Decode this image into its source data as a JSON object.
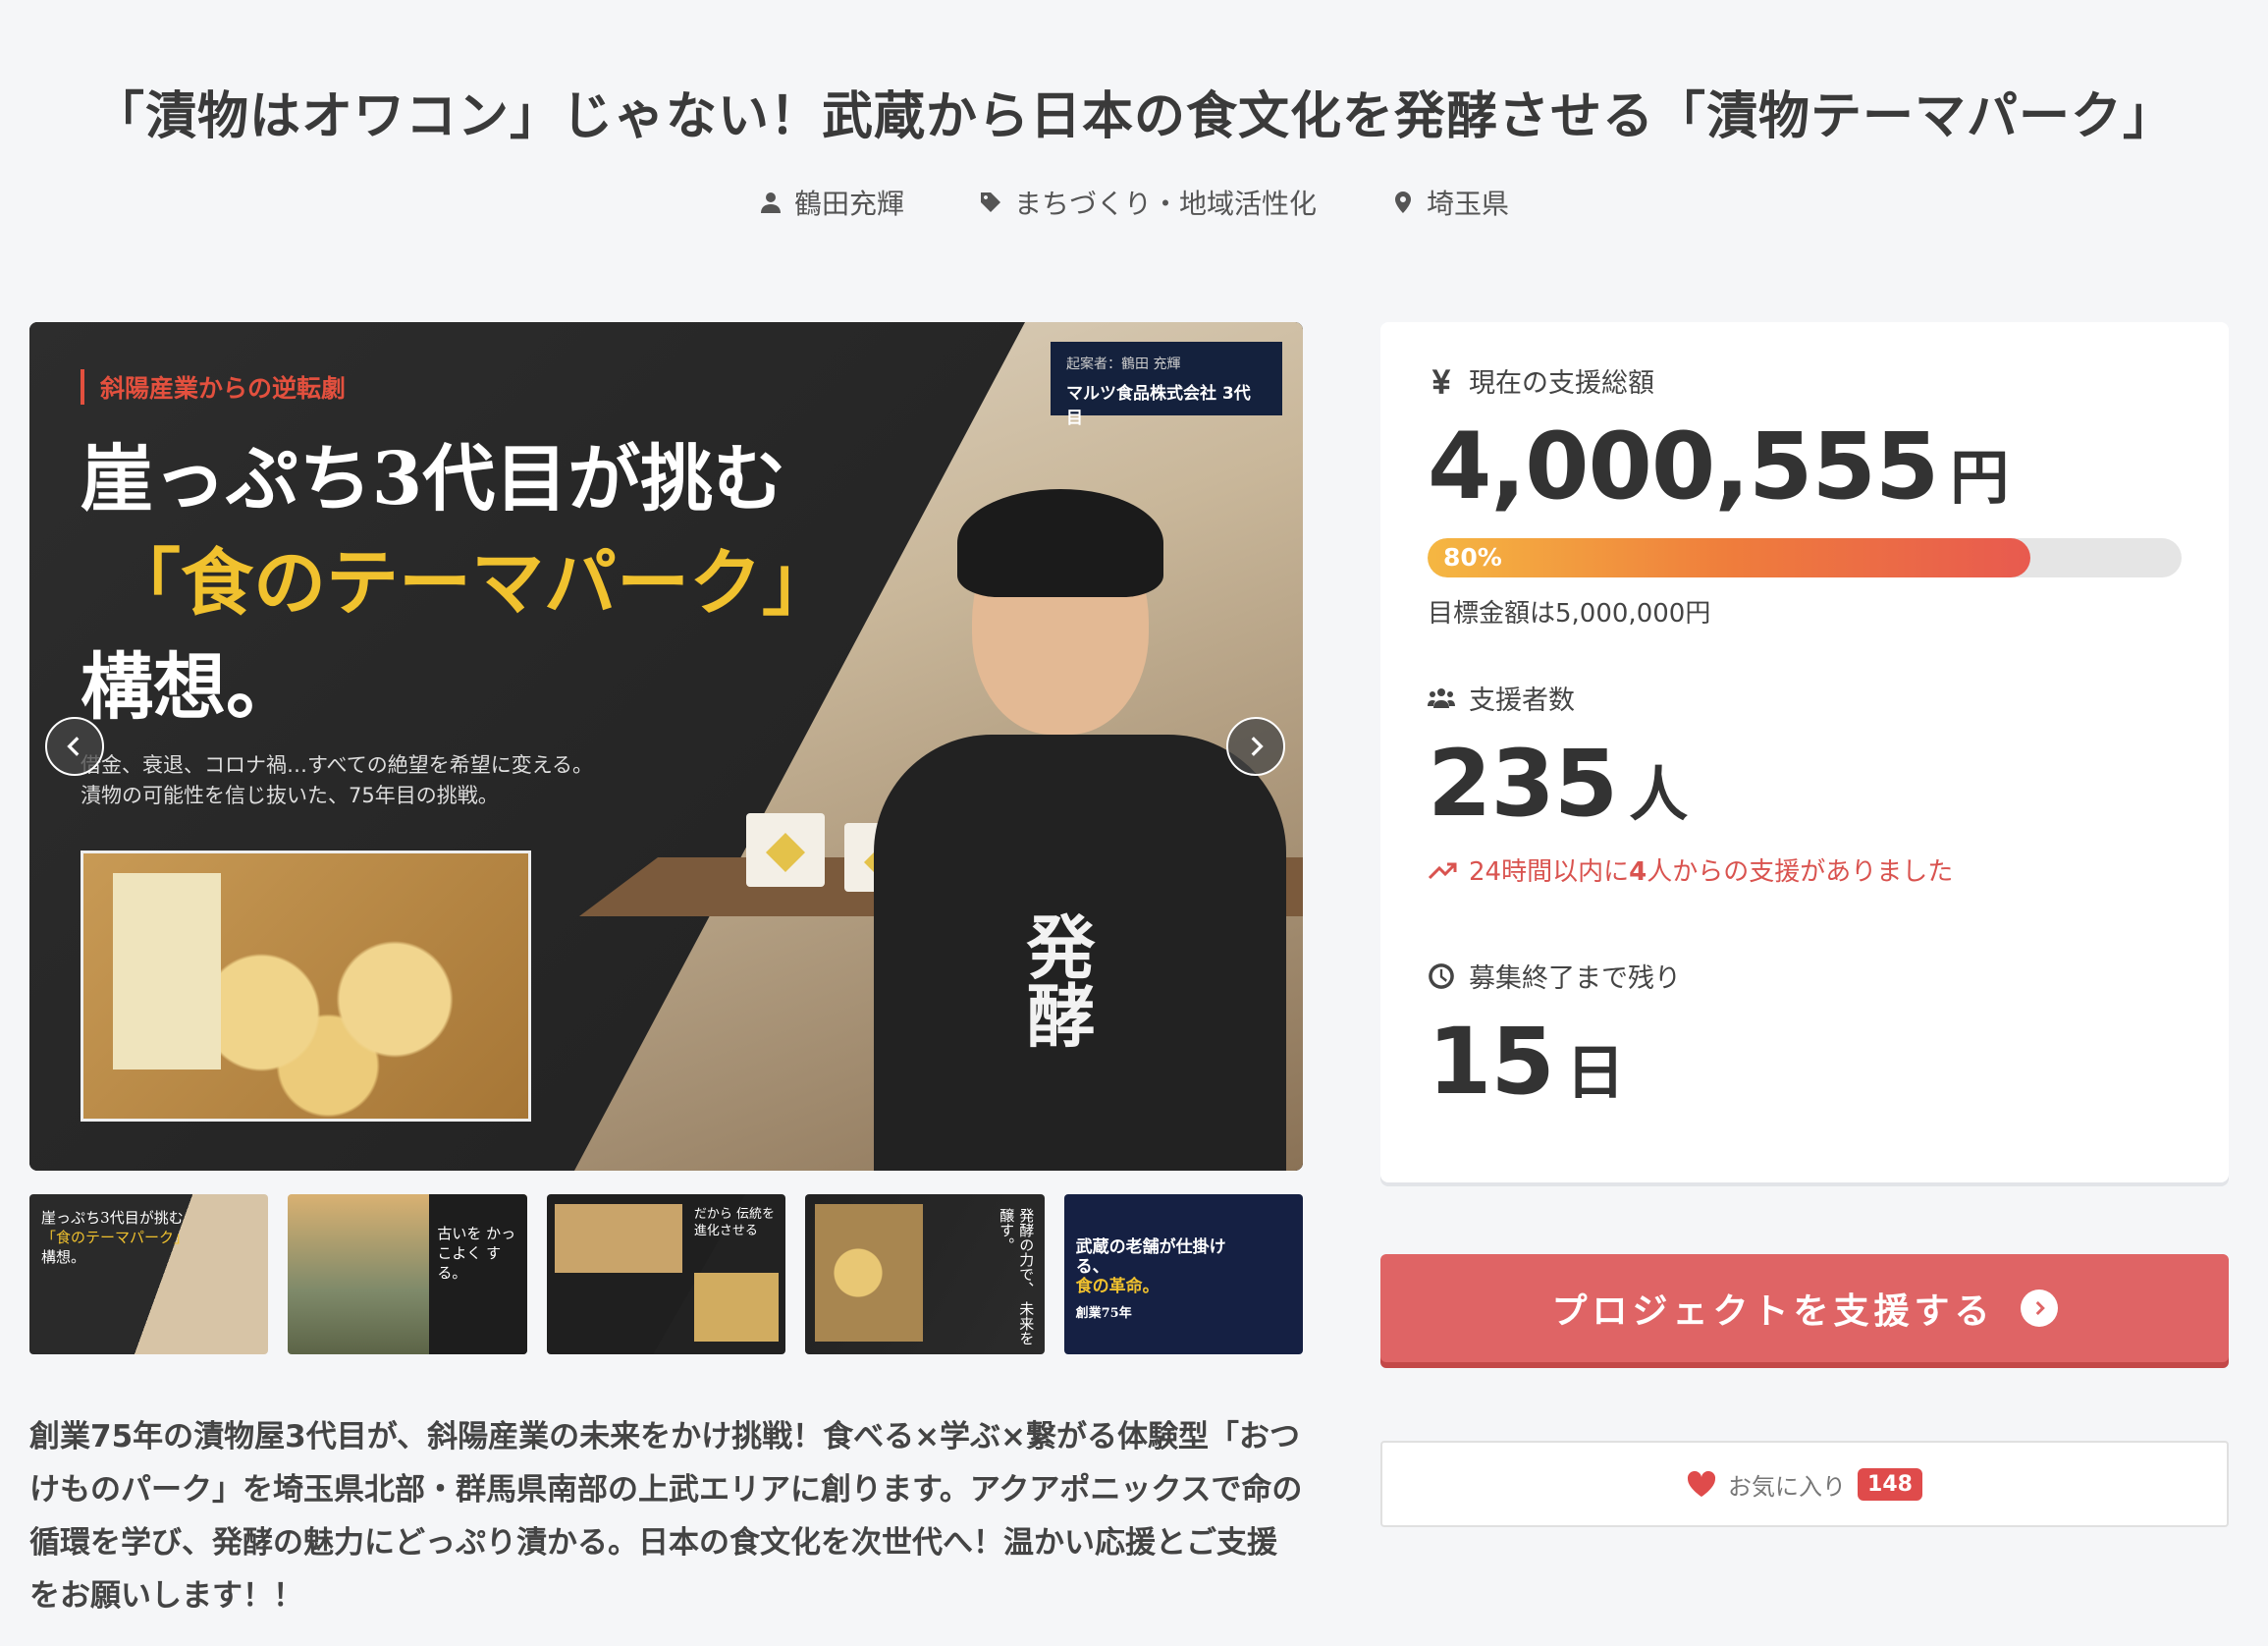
{
  "title": "「漬物はオワコン」じゃない！武蔵から日本の食文化を発酵させる「漬物テーマパーク」",
  "meta": {
    "author": "鶴田充輝",
    "category": "まちづくり・地域活性化",
    "location": "埼玉県"
  },
  "hero": {
    "tag": "斜陽産業からの逆転劇",
    "badge_line1": "起案者：鶴田 充輝",
    "badge_line2": "マルツ食品株式会社 3代目",
    "headline1": "崖っぷち3代目が挑む",
    "headline2": "「食のテーマパーク」",
    "headline3": "構想。",
    "sub1": "借金、衰退、コロナ禍…すべての絶望を希望に変える。",
    "sub2": "漬物の可能性を信じ抜いた、75年目の挑戦。",
    "shirt_text": "発酵"
  },
  "thumbnails": [
    {
      "text": "崖っぷち3代目が挑む",
      "gold": "「食のテーマパーク」",
      "tail": "構想。"
    },
    {
      "text": "",
      "gold": "",
      "tail": "古いを かっこよく する。"
    },
    {
      "text": "",
      "gold": "",
      "tail": "だから 伝統を 進化させる"
    },
    {
      "text": "",
      "gold": "",
      "tail": "発酵の力で、 未来を醸す。"
    },
    {
      "text": "武蔵の老舗が仕掛ける、",
      "gold": "食の革命。",
      "tail": "創業75年"
    }
  ],
  "description": "創業75年の漬物屋3代目が、斜陽産業の未来をかけ挑戦！食べる×学ぶ×繋がる体験型「おつけものパーク」を埼玉県北部・群馬県南部の上武エリアに創ります。アクアポニックスで命の循環を学び、発酵の魅力にどっぷり漬かる。日本の食文化を次世代へ！温かい応援とご支援をお願いします！！",
  "funding": {
    "label": "現在の支援総額",
    "amount": "4,000,555",
    "unit": "円",
    "progress_text": "80%",
    "progress_fraction": 0.8,
    "target": "目標金額は5,000,000円"
  },
  "supporters": {
    "label": "支援者数",
    "count": "235",
    "unit": "人",
    "recent_prefix": "24時間以内に",
    "recent_count": "4",
    "recent_suffix": "人からの支援がありました"
  },
  "remaining": {
    "label": "募集終了まで残り",
    "count": "15",
    "unit": "日"
  },
  "buttons": {
    "support": "プロジェクトを支援する",
    "favorite": "お気に入り",
    "favorite_count": "148"
  },
  "colors": {
    "accent": "#df6465",
    "progress_start": "#f5b742",
    "progress_end": "#e85a4f",
    "recent": "#d9534f"
  }
}
